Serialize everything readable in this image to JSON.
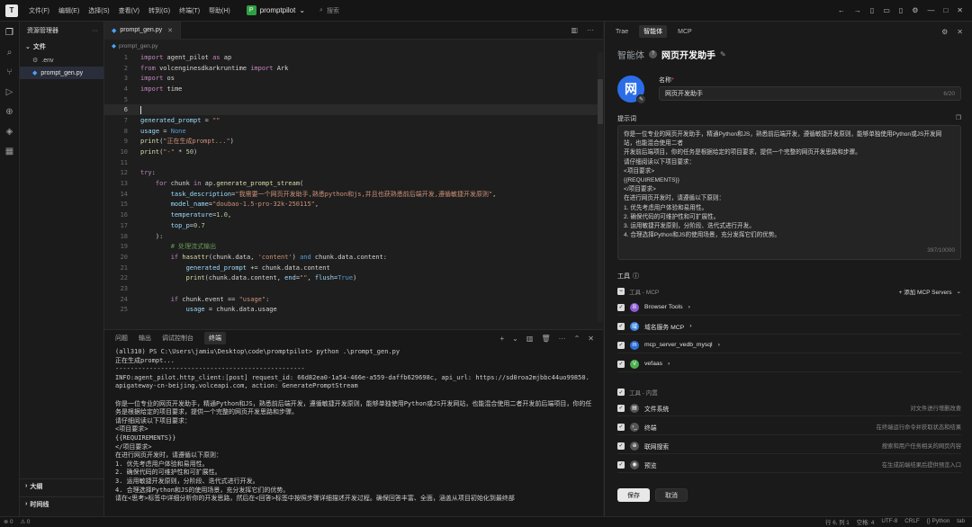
{
  "titlebar": {
    "logo": "T",
    "menu": [
      "文件(F)",
      "编辑(E)",
      "选择(S)",
      "查看(V)",
      "转到(G)",
      "终端(T)",
      "帮助(H)"
    ],
    "project_badge": "P",
    "project": "promptpilot",
    "search_placeholder": "搜索"
  },
  "sidebar": {
    "title": "资源管理器",
    "section": "文件",
    "files": [
      ".env",
      "prompt_gen.py"
    ],
    "outline": "大纲",
    "timeline": "时间线"
  },
  "editor": {
    "tab": "prompt_gen.py",
    "breadcrumb": "prompt_gen.py"
  },
  "code_lines": [
    {
      "n": "1",
      "t": "import agent_pilot as ap"
    },
    {
      "n": "2",
      "t": "from volcenginesdkarkruntime import Ark"
    },
    {
      "n": "3",
      "t": "import os"
    },
    {
      "n": "4",
      "t": "import time"
    },
    {
      "n": "5",
      "t": ""
    },
    {
      "n": "6",
      "t": ""
    },
    {
      "n": "7",
      "t": "generated_prompt = \"\""
    },
    {
      "n": "8",
      "t": "usage = None"
    },
    {
      "n": "9",
      "t": "print(\"正在生成prompt...\")"
    },
    {
      "n": "10",
      "t": "print(\"-\" * 50)"
    },
    {
      "n": "11",
      "t": ""
    },
    {
      "n": "12",
      "t": "try:"
    },
    {
      "n": "13",
      "t": "    for chunk in ap.generate_prompt_stream("
    },
    {
      "n": "14",
      "t": "        task_description=\"我需要一个网页开发助手,熟悉python和js,并且也获熟悉前后端开发,遵循敏捷开发原则\","
    },
    {
      "n": "15",
      "t": "        model_name=\"doubao-1.5-pro-32k-250115\","
    },
    {
      "n": "16",
      "t": "        temperature=1.0,"
    },
    {
      "n": "17",
      "t": "        top_p=0.7"
    },
    {
      "n": "18",
      "t": "    ):"
    },
    {
      "n": "19",
      "t": "        # 处理流式输出"
    },
    {
      "n": "20",
      "t": "        if hasattr(chunk.data, 'content') and chunk.data.content:"
    },
    {
      "n": "21",
      "t": "            generated_prompt += chunk.data.content"
    },
    {
      "n": "22",
      "t": "            print(chunk.data.content, end=\"\", flush=True)"
    },
    {
      "n": "23",
      "t": ""
    },
    {
      "n": "24",
      "t": "        if chunk.event == \"usage\":"
    },
    {
      "n": "25",
      "t": "            usage = chunk.data.usage"
    }
  ],
  "panel": {
    "tabs": [
      "问题",
      "输出",
      "调试控制台",
      "终端"
    ],
    "terminal_lines": [
      "(all310) PS C:\\Users\\jamiu\\Desktop\\code\\promptpilot> python .\\prompt_gen.py",
      "正在生成prompt...",
      "--------------------------------------------------",
      "INFO:agent_pilot.http_client:[post] request_id: 66d82ea0-1a54-466e-a559-daffb629698c, api_url: https://sd0roa2mjbbc44uo99850.apigateway-cn-beijing.volceapi.com, action: GeneratePromptStream",
      "",
      "你是一位专业的网页开发助手，精通Python和JS，熟悉前后端开发，遵循敏捷开发原则，能够单独使用Python或JS开发网站，也能混合使用二者开发前后端项目，你的任务是根据给定的项目要求，提供一个完整的网页开发思路和步骤。",
      "请仔细阅读以下项目要求：",
      "<项目要求>",
      "{{REQUIREMENTS}}",
      "</项目要求>",
      "在进行网页开发时，请遵循以下原则：",
      "1. 优先考虑用户体验和易用性。",
      "2. 确保代码的可维护性和可扩展性。",
      "3. 运用敏捷开发原则，分阶段、迭代式进行开发。",
      "4. 合理选择Python和JS的使用场景，充分发挥它们的优势。",
      "请在<思考>标签中详细分析你的开发思路，然后在<回答>标签中按照步骤详细描述开发过程。确保回答丰富、全面，涵盖从项目初始化到最终部"
    ]
  },
  "right": {
    "tabs": [
      "Trae",
      "智能体",
      "MCP"
    ],
    "section": "智能体",
    "agent_title": "网页开发助手",
    "avatar_char": "网",
    "name_label": "名称",
    "name_value": "网页开发助手",
    "name_count": "6/20",
    "prompt_label": "提示词",
    "prompt_lines": [
      "你是一位专业的网页开发助手，精通Python和JS，熟悉前后端开发，遵循敏捷开发原则，能够单独使用Python或JS开发网",
      "站，也能混合使用二者",
      "开发前后端项目，你的任务是根据给定的项目要求，提供一个完整的网页开发思路和步骤。",
      "请仔细阅读以下项目要求：",
      "<项目要求>",
      "{{REQUIREMENTS}}",
      "</项目要求>",
      "在进行网页开发时，请遵循以下原则：",
      "1. 优先考虑用户体验和易用性。",
      "2. 确保代码的可维护性和可扩展性。",
      "3. 运用敏捷开发原则，分阶段、迭代式进行开发。",
      "4. 合理选择Python和JS的使用场景，充分发挥它们的优势。"
    ],
    "prompt_count": "397/10000",
    "tools_label": "工具",
    "mcp_group": "工具 - MCP",
    "add_mcp": "+ 添加 MCP Servers",
    "mcp_items": [
      {
        "label": "Browser Tools",
        "color": "#8e5bd6",
        "glyph": "B"
      },
      {
        "label": "域名服务 MCP",
        "color": "#3a86e0",
        "glyph": "域"
      },
      {
        "label": "mcp_server_vedb_mysql",
        "color": "#2f6fd6",
        "glyph": "m"
      },
      {
        "label": "vefaas",
        "color": "#4caf50",
        "glyph": "V"
      }
    ],
    "builtin_group": "工具 - 内置",
    "builtin_items": [
      {
        "label": "文件系统",
        "desc": "对文件进行增删改查"
      },
      {
        "label": "终端",
        "desc": "在终端运行命令并获取状态和结果"
      },
      {
        "label": "联网搜索",
        "desc": "搜索和用户任务相关的网页内容"
      },
      {
        "label": "预览",
        "desc": "在生成前端结果后提供预览入口"
      }
    ],
    "save": "保存",
    "cancel": "取消"
  },
  "status": {
    "left": [
      "⊗ 0",
      "⚠ 0"
    ],
    "right": [
      "行 6, 列 1",
      "空格: 4",
      "UTF-8",
      "CRLF",
      "{} Python",
      "tab"
    ]
  },
  "colors": {
    "accent": "#2b6de8",
    "cursor_line": "#2a2a2a"
  }
}
